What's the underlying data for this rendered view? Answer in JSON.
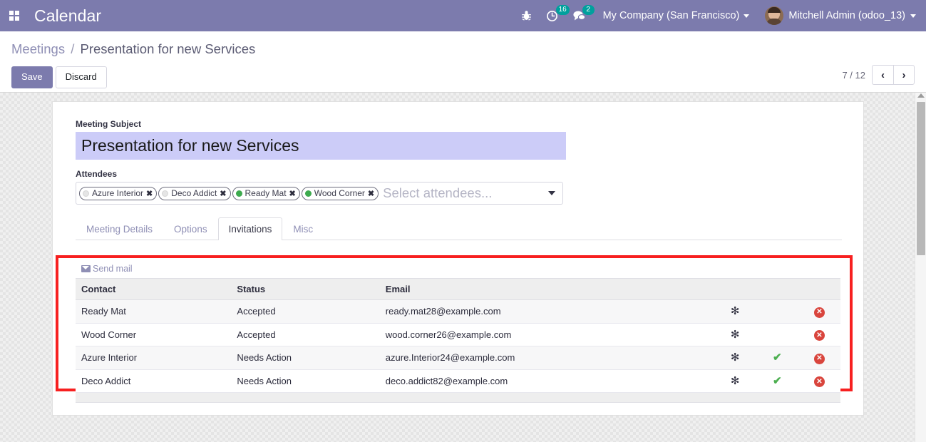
{
  "navbar": {
    "apps_icon": "apps-grid-icon",
    "brand": "Calendar",
    "bug_icon": "bug-icon",
    "activity_icon": "clock-activity-icon",
    "activity_count": "16",
    "messages_icon": "chat-bubble-icon",
    "messages_count": "2",
    "company": "My Company (San Francisco)",
    "user": "Mitchell Admin (odoo_13)",
    "avatar_icon": "user-avatar"
  },
  "control_panel": {
    "breadcrumb_root": "Meetings",
    "breadcrumb_separator": "/",
    "breadcrumb_current": "Presentation for new Services",
    "save_label": "Save",
    "discard_label": "Discard",
    "pager_count": "7 / 12",
    "pager_prev_icon": "chevron-left-icon",
    "pager_next_icon": "chevron-right-icon",
    "pager_prev": "‹",
    "pager_next": "›"
  },
  "form": {
    "subject_label": "Meeting Subject",
    "subject_value": "Presentation for new Services",
    "attendees_label": "Attendees",
    "attendees_placeholder": "Select attendees...",
    "dropdown_icon": "caret-down-icon",
    "tags": [
      {
        "label": "Azure Interior",
        "dot_color": "#e5e5e5",
        "remove_icon": "tag-remove-icon",
        "remove_glyph": "✖"
      },
      {
        "label": "Deco Addict",
        "dot_color": "#e5e5e5",
        "remove_icon": "tag-remove-icon",
        "remove_glyph": "✖"
      },
      {
        "label": "Ready Mat",
        "dot_color": "#3daa4e",
        "remove_icon": "tag-remove-icon",
        "remove_glyph": "✖"
      },
      {
        "label": "Wood Corner",
        "dot_color": "#3daa4e",
        "remove_icon": "tag-remove-icon",
        "remove_glyph": "✖"
      }
    ],
    "tabs": [
      {
        "label": "Meeting Details",
        "active": false
      },
      {
        "label": "Options",
        "active": false
      },
      {
        "label": "Invitations",
        "active": true
      },
      {
        "label": "Misc",
        "active": false
      }
    ]
  },
  "invitations": {
    "send_mail_label": "Send mail",
    "send_mail_icon": "envelope-icon",
    "highlight_color": "#f72020",
    "columns": [
      "Contact",
      "Status",
      "Email"
    ],
    "rows": [
      {
        "contact": "Ready Mat",
        "status": "Accepted",
        "email": "ready.mat28@example.com",
        "asterisk_icon": "asterisk-icon",
        "asterisk_glyph": "✻",
        "has_accept": false,
        "accept_icon": "check-icon",
        "accept_glyph": "✔",
        "delete_icon": "delete-circle-icon",
        "delete_glyph": "✕"
      },
      {
        "contact": "Wood Corner",
        "status": "Accepted",
        "email": "wood.corner26@example.com",
        "asterisk_icon": "asterisk-icon",
        "asterisk_glyph": "✻",
        "has_accept": false,
        "accept_icon": "check-icon",
        "accept_glyph": "✔",
        "delete_icon": "delete-circle-icon",
        "delete_glyph": "✕"
      },
      {
        "contact": "Azure Interior",
        "status": "Needs Action",
        "email": "azure.Interior24@example.com",
        "asterisk_icon": "asterisk-icon",
        "asterisk_glyph": "✻",
        "has_accept": true,
        "accept_icon": "check-icon",
        "accept_glyph": "✔",
        "delete_icon": "delete-circle-icon",
        "delete_glyph": "✕"
      },
      {
        "contact": "Deco Addict",
        "status": "Needs Action",
        "email": "deco.addict82@example.com",
        "asterisk_icon": "asterisk-icon",
        "asterisk_glyph": "✻",
        "has_accept": true,
        "accept_icon": "check-icon",
        "accept_glyph": "✔",
        "delete_icon": "delete-circle-icon",
        "delete_glyph": "✕"
      }
    ]
  },
  "scrollbar": {
    "up_arrow_icon": "scroll-up-arrow-icon",
    "thumb_icon": "scroll-thumb"
  },
  "colors": {
    "brand_purple": "#7c7bad",
    "badge_teal": "#00a09d",
    "accent_red": "#f72020",
    "status_green": "#3daa4e",
    "link_purple": "#8f8fb5"
  }
}
